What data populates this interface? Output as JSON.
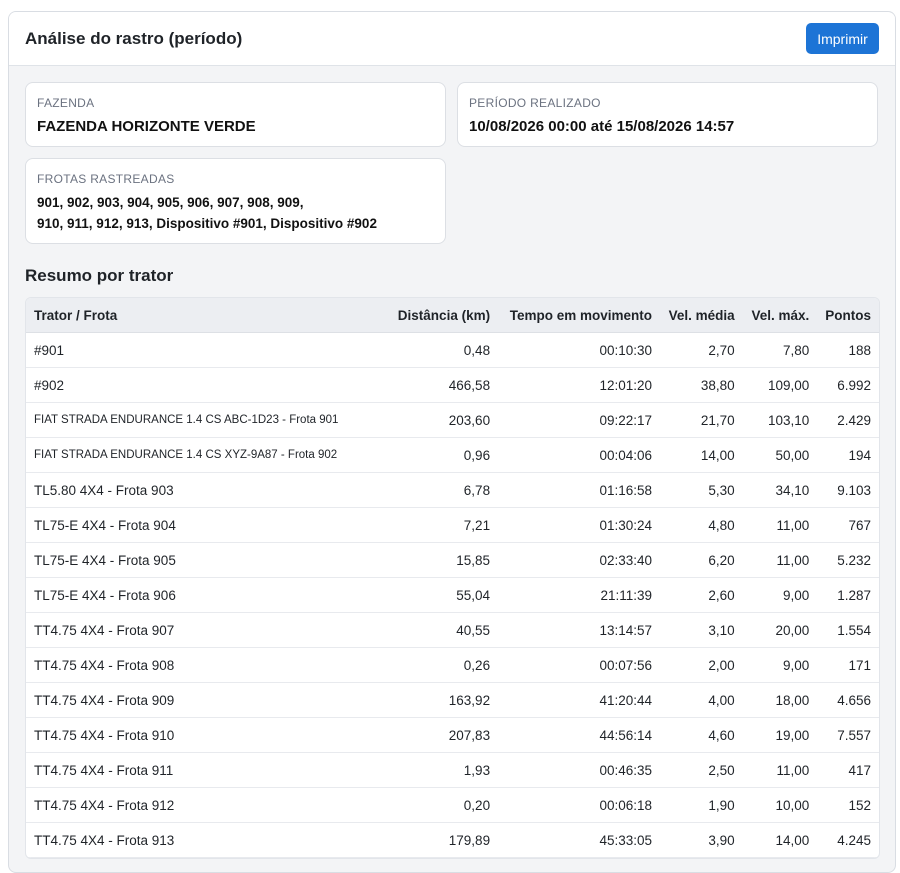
{
  "header": {
    "title": "Análise do rastro (período)",
    "print_label": "Imprimir"
  },
  "farm": {
    "label": "FAZENDA",
    "value": "FAZENDA HORIZONTE VERDE"
  },
  "period": {
    "label": "PERÍODO REALIZADO",
    "value": "10/08/2026 00:00 até 15/08/2026 14:57"
  },
  "fleets": {
    "label": "FROTAS RASTREADAS",
    "line1": "901, 902, 903, 904, 905, 906, 907, 908, 909,",
    "line2": "910, 911, 912, 913, Dispositivo #901, Dispositivo #902"
  },
  "summary": {
    "title": "Resumo por trator",
    "columns": [
      "Trator / Frota",
      "Distância (km)",
      "Tempo em movimento",
      "Vel. média",
      "Vel. máx.",
      "Pontos"
    ],
    "rows": [
      [
        "#901",
        "0,48",
        "00:10:30",
        "2,70",
        "7,80",
        "188"
      ],
      [
        "#902",
        "466,58",
        "12:01:20",
        "38,80",
        "109,00",
        "6.992"
      ],
      [
        "FIAT STRADA ENDURANCE 1.4 CS ABC-1D23 - Frota 901",
        "203,60",
        "09:22:17",
        "21,70",
        "103,10",
        "2.429"
      ],
      [
        "FIAT STRADA ENDURANCE 1.4 CS XYZ-9A87 - Frota 902",
        "0,96",
        "00:04:06",
        "14,00",
        "50,00",
        "194"
      ],
      [
        "TL5.80 4X4 - Frota 903",
        "6,78",
        "01:16:58",
        "5,30",
        "34,10",
        "9.103"
      ],
      [
        "TL75-E 4X4 - Frota 904",
        "7,21",
        "01:30:24",
        "4,80",
        "11,00",
        "767"
      ],
      [
        "TL75-E 4X4 - Frota 905",
        "15,85",
        "02:33:40",
        "6,20",
        "11,00",
        "5.232"
      ],
      [
        "TL75-E 4X4 - Frota 906",
        "55,04",
        "21:11:39",
        "2,60",
        "9,00",
        "1.287"
      ],
      [
        "TT4.75 4X4 - Frota 907",
        "40,55",
        "13:14:57",
        "3,10",
        "20,00",
        "1.554"
      ],
      [
        "TT4.75 4X4 - Frota 908",
        "0,26",
        "00:07:56",
        "2,00",
        "9,00",
        "171"
      ],
      [
        "TT4.75 4X4 - Frota 909",
        "163,92",
        "41:20:44",
        "4,00",
        "18,00",
        "4.656"
      ],
      [
        "TT4.75 4X4 - Frota 910",
        "207,83",
        "44:56:14",
        "4,60",
        "19,00",
        "7.557"
      ],
      [
        "TT4.75 4X4 - Frota 911",
        "1,93",
        "00:46:35",
        "2,50",
        "11,00",
        "417"
      ],
      [
        "TT4.75 4X4 - Frota 912",
        "0,20",
        "00:06:18",
        "1,90",
        "10,00",
        "152"
      ],
      [
        "TT4.75 4X4 - Frota 913",
        "179,89",
        "45:33:05",
        "3,90",
        "14,00",
        "4.245"
      ]
    ]
  }
}
